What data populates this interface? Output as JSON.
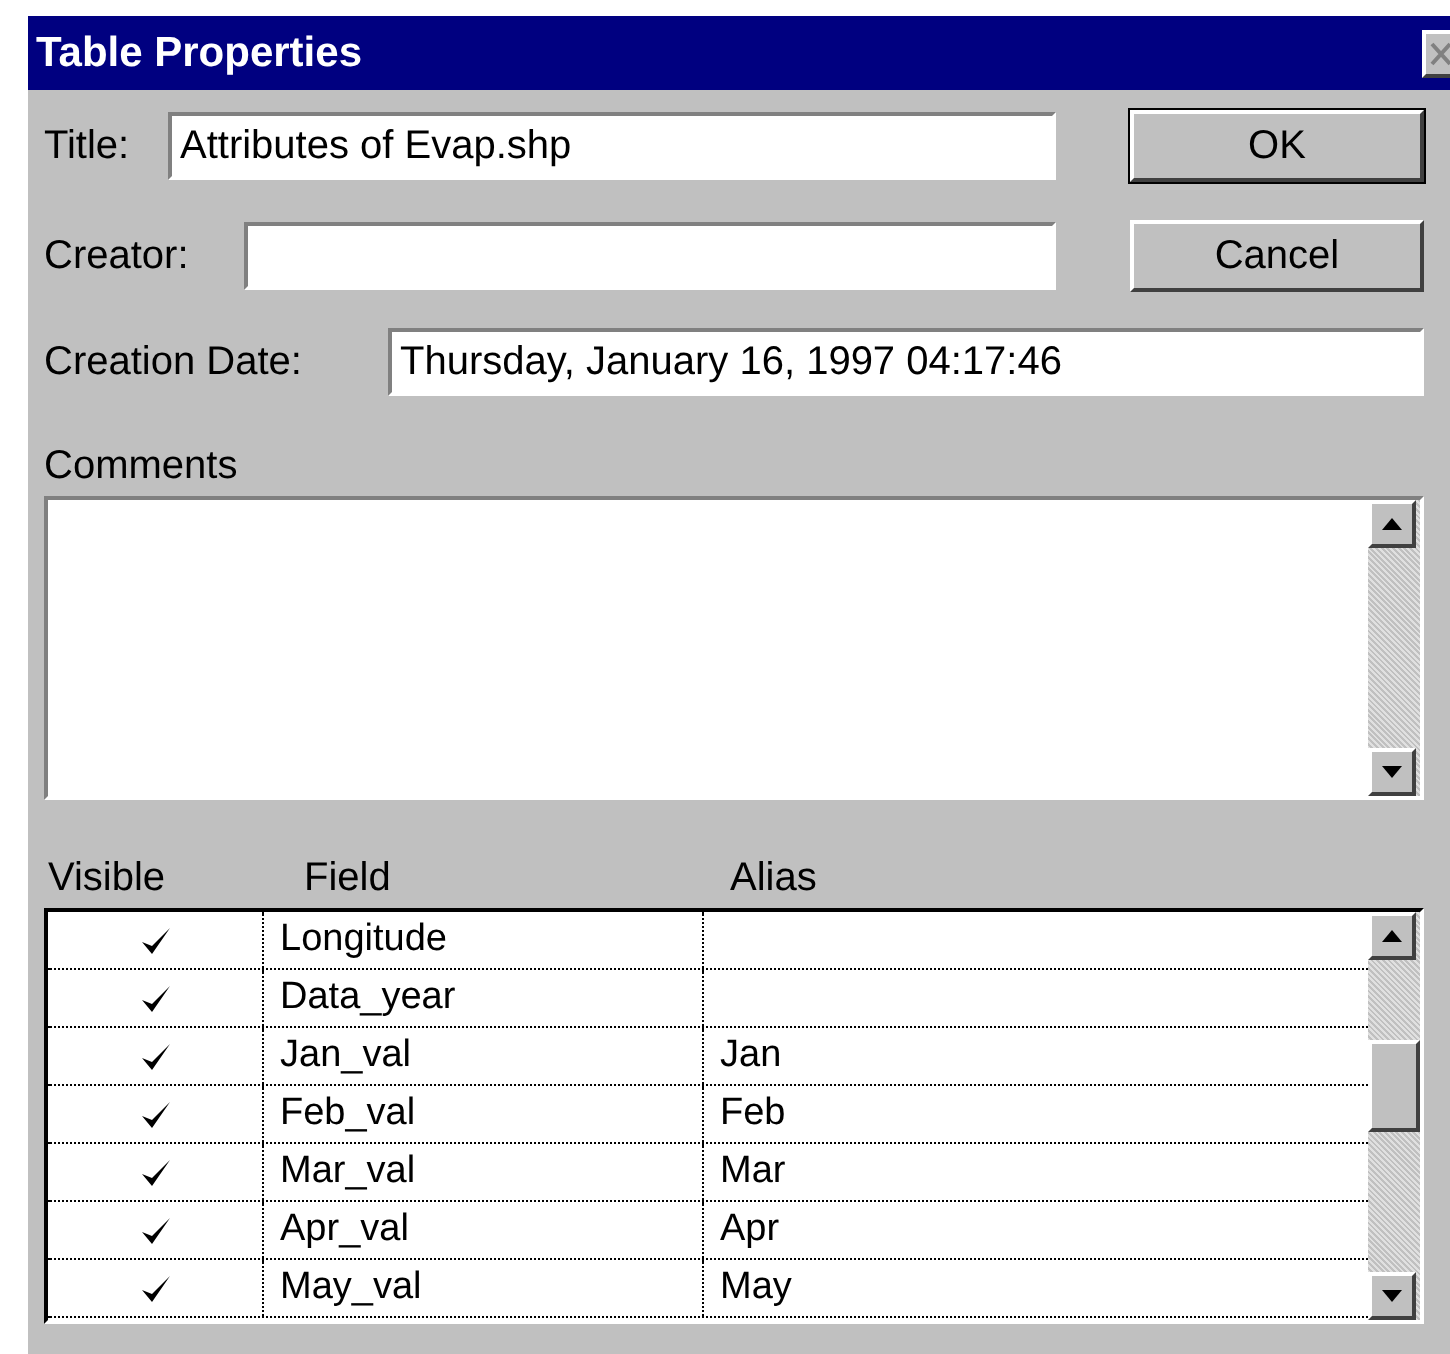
{
  "window": {
    "title": "Table Properties"
  },
  "fields": [
    {
      "label": "Title:",
      "value": "Attributes of Evap.shp"
    },
    {
      "label": "Creator:"
    },
    {
      "label": "Creation Date:",
      "value": "Thursday, January 16, 1997 04:17:46"
    }
  ],
  "buttons": [
    "OK",
    "Cancel"
  ],
  "comments": {
    "label": "Comments"
  },
  "table": {
    "columns": [
      "Visible",
      "Field",
      "Alias"
    ],
    "rows": [
      {
        "visible": true,
        "field": "Longitude"
      },
      {
        "visible": true,
        "field": "Data_year"
      },
      {
        "visible": true,
        "field": "Jan_val",
        "alias": "Jan"
      },
      {
        "visible": true,
        "field": "Feb_val",
        "alias": "Feb"
      },
      {
        "visible": true,
        "field": "Mar_val",
        "alias": "Mar"
      },
      {
        "visible": true,
        "field": "Apr_val",
        "alias": "Apr"
      },
      {
        "visible": true,
        "field": "May_val",
        "alias": "May"
      }
    ]
  }
}
